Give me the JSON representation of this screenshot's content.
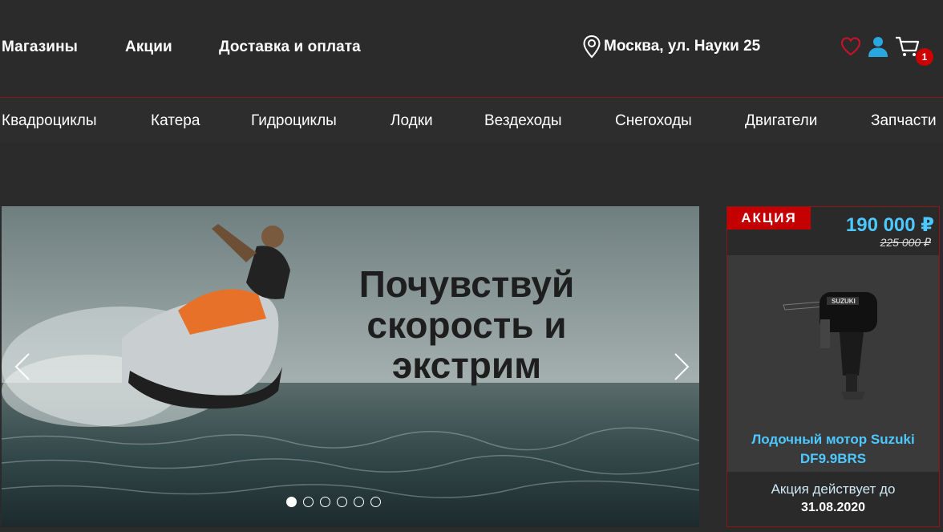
{
  "header": {
    "nav": [
      "Магазины",
      "Акции",
      "Доставка и оплата"
    ],
    "location": "Москва, ул. Науки 25",
    "cart_count": "1",
    "icons": [
      "map-pin-icon",
      "heart-icon",
      "user-icon",
      "cart-icon"
    ]
  },
  "categories": [
    "Квадроциклы",
    "Катера",
    "Гидроциклы",
    "Лодки",
    "Вездеходы",
    "Снегоходы",
    "Двигатели",
    "Запчасти"
  ],
  "slider": {
    "title": "Почувствуй скорость и экстрим",
    "slides_total": 6,
    "active_slide": 1
  },
  "promo": {
    "badge": "АКЦИЯ",
    "price": "190 000 ₽",
    "old_price": "225 000 ₽",
    "product_name": "Лодочный мотор Suzuki DF9.9BRS",
    "valid_label": "Акция действует до",
    "valid_date": "31.08.2020"
  },
  "colors": {
    "background": "#2b2b2b",
    "accent_red": "#c40000",
    "accent_blue": "#4cc8ff"
  }
}
